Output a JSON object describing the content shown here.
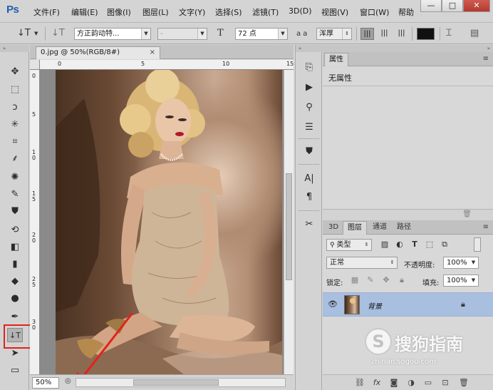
{
  "app": {
    "logo": "Ps"
  },
  "menu": [
    "文件(F)",
    "编辑(E)",
    "图像(I)",
    "图层(L)",
    "文字(Y)",
    "选择(S)",
    "滤镜(T)",
    "3D(D)",
    "视图(V)",
    "窗口(W)",
    "帮助"
  ],
  "window_controls": {
    "minimize": "—",
    "maximize": "□",
    "close": "✕"
  },
  "options_bar": {
    "tool_icon": "↓T",
    "orient_icon": "↓T",
    "font_family": "方正韵动特...",
    "font_style": "-",
    "size_icon": "T",
    "font_size": "72 点",
    "aa_icon": "a a",
    "antialias": "浑厚",
    "align": [
      "left",
      "center",
      "right"
    ]
  },
  "document": {
    "tab_title": "0.jpg @ 50%(RGB/8#)",
    "zoom": "50%",
    "ruler_top": [
      "0",
      "5",
      "10",
      "15"
    ],
    "ruler_left": [
      "0",
      "5",
      "1 0",
      "1 5",
      "2 0",
      "2 5",
      "3 0"
    ]
  },
  "toolbar": {
    "tools": [
      {
        "name": "move-tool",
        "glyph": "✥"
      },
      {
        "name": "marquee-tool",
        "glyph": "⬚"
      },
      {
        "name": "lasso-tool",
        "glyph": "ↄ"
      },
      {
        "name": "quick-select-tool",
        "glyph": "✳"
      },
      {
        "name": "crop-tool",
        "glyph": "⌗"
      },
      {
        "name": "eyedropper-tool",
        "glyph": "⸙"
      },
      {
        "name": "healing-tool",
        "glyph": "✺"
      },
      {
        "name": "brush-tool",
        "glyph": "✎"
      },
      {
        "name": "stamp-tool",
        "glyph": "⛊"
      },
      {
        "name": "history-brush-tool",
        "glyph": "⟲"
      },
      {
        "name": "eraser-tool",
        "glyph": "◧"
      },
      {
        "name": "gradient-tool",
        "glyph": "▮"
      },
      {
        "name": "blur-tool",
        "glyph": "◆"
      },
      {
        "name": "dodge-tool",
        "glyph": "●"
      },
      {
        "name": "pen-tool",
        "glyph": "✒"
      },
      {
        "name": "type-tool",
        "glyph": "↓T"
      },
      {
        "name": "path-select-tool",
        "glyph": "➤"
      },
      {
        "name": "shape-tool",
        "glyph": "▭"
      }
    ]
  },
  "properties_panel": {
    "tabs": [
      "属性"
    ],
    "content": "无属性"
  },
  "layers_panel": {
    "tabs": [
      "3D",
      "图层",
      "通道",
      "路径"
    ],
    "filter_kind": "类型",
    "blend_mode": "正常",
    "opacity_label": "不透明度:",
    "opacity": "100%",
    "lock_label": "锁定:",
    "fill_label": "填充:",
    "fill": "100%",
    "layers": [
      {
        "name": "背景",
        "visible": true,
        "locked": true
      }
    ]
  },
  "watermark": {
    "logo": "S",
    "text": "搜狗指南",
    "url": "zhinan.sogou.com"
  },
  "colors": {
    "accent_red": "#e2231a",
    "layer_selected": "#a9bfe0"
  }
}
